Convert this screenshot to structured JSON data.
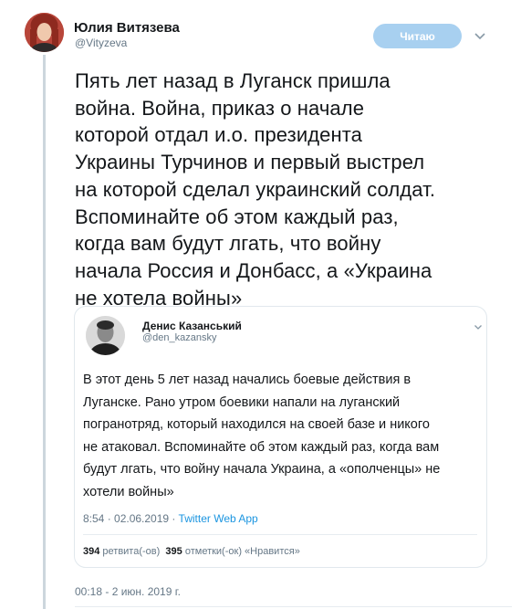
{
  "author": {
    "name": "Юлия Витязева",
    "handle": "@Vityzeva",
    "follow_label": "Читаю"
  },
  "tweet": {
    "lines": [
      "Пять лет назад в Луганск пришла",
      "война. Война, приказ о начале",
      "которой отдал и.о. президента",
      "Украины Турчинов и первый выстрел",
      "на которой сделал украинский солдат.",
      "Вспоминайте об этом каждый раз,",
      "когда вам будут лгать, что войну",
      "начала Россия и Донбасс, а «Украина",
      "не хотела войны»"
    ],
    "timestamp": "00:18 - 2 июн. 2019 г."
  },
  "quoted": {
    "name": "Денис Казанський",
    "handle": "@den_kazansky",
    "lines": [
      "В этот день 5 лет назад начались боевые действия в",
      "Луганске. Рано утром боевики напали на луганский",
      "погранотряд, который находился на своей базе и никого",
      "не атаковал. Вспоминайте об этом каждый раз, когда вам",
      "будут лгать, что войну начала Украина, а «ополченцы» не",
      "хотели войны»"
    ],
    "time": "8:54 · 02.06.2019 · ",
    "app": "Twitter Web App",
    "retweets_count": "394",
    "retweets_label": " ретвита(-ов)",
    "likes_count": "395",
    "likes_label": " отметки(-ок) «Нравится»"
  },
  "colors": {
    "link": "#1b95e0",
    "muted": "#657786",
    "follow_bg": "#a8d0f0",
    "thread_line": "#ccd6dd"
  }
}
